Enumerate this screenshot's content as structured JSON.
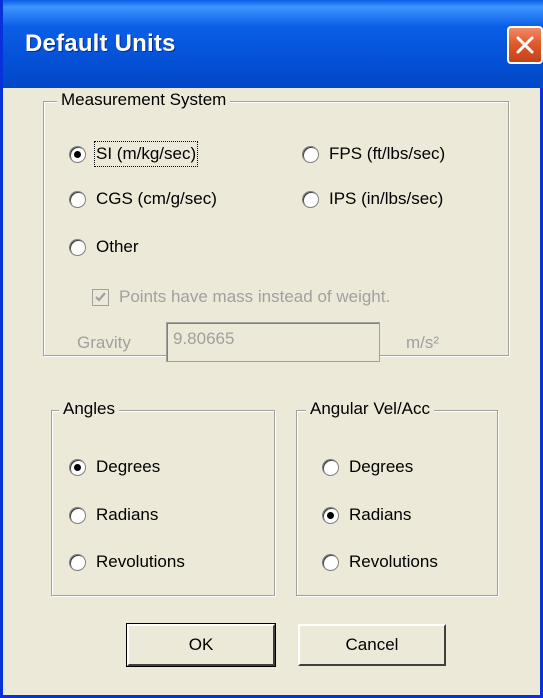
{
  "window": {
    "title": "Default Units"
  },
  "measurement": {
    "legend": "Measurement System",
    "si": "SI (m/kg/sec)",
    "fps": "FPS (ft/lbs/sec)",
    "cgs": "CGS (cm/g/sec)",
    "ips": "IPS (in/lbs/sec)",
    "other": "Other",
    "selected": "SI (m/kg/sec)",
    "mass_checkbox": "Points have mass instead of weight.",
    "mass_checked": true,
    "gravity_label": "Gravity",
    "gravity_value": "9.80665",
    "gravity_unit": "m/s²"
  },
  "angles": {
    "legend": "Angles",
    "degrees": "Degrees",
    "radians": "Radians",
    "revolutions": "Revolutions",
    "selected": "Degrees"
  },
  "angular": {
    "legend": "Angular Vel/Acc",
    "degrees": "Degrees",
    "radians": "Radians",
    "revolutions": "Revolutions",
    "selected": "Radians"
  },
  "buttons": {
    "ok": "OK",
    "cancel": "Cancel"
  }
}
